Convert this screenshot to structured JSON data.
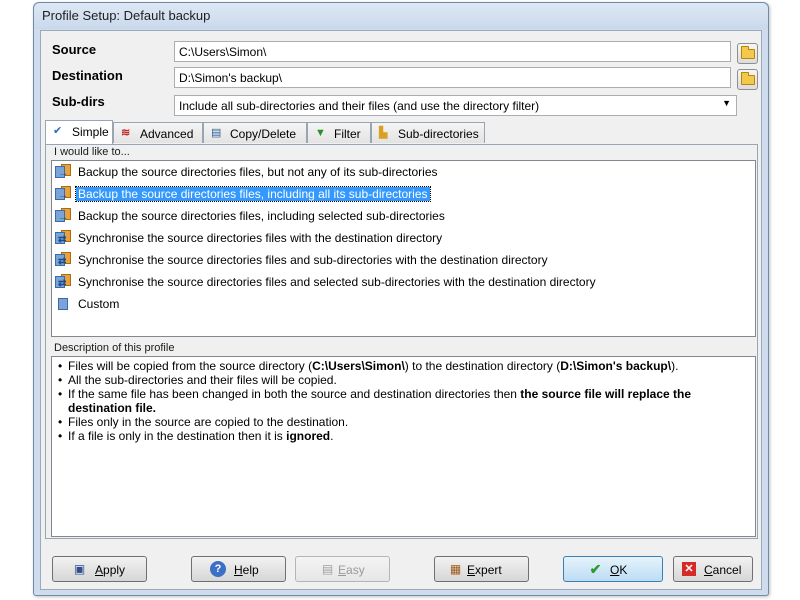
{
  "window": {
    "title": "Profile Setup: Default backup"
  },
  "fields": {
    "source_label": "Source",
    "source_value": "C:\\Users\\Simon\\",
    "destination_label": "Destination",
    "destination_value": "D:\\Simon's backup\\",
    "subdirs_label": "Sub-dirs",
    "subdirs_value": "Include all sub-directories and their files (and use the directory filter)"
  },
  "tabs": [
    {
      "label": "Simple",
      "icon": "checkmarks-icon"
    },
    {
      "label": "Advanced",
      "icon": "advanced-icon"
    },
    {
      "label": "Copy/Delete",
      "icon": "copy-delete-icon"
    },
    {
      "label": "Filter",
      "icon": "filter-icon"
    },
    {
      "label": "Sub-directories",
      "icon": "subdirectories-icon"
    }
  ],
  "simple": {
    "group_label": "I would like to...",
    "options": [
      "Backup the source directories files, but not any of its sub-directories",
      "Backup the source directories files, including all its sub-directories",
      "Backup the source directories files, including selected sub-directories",
      "Synchronise the source directories files with the destination directory",
      "Synchronise the source directories files and sub-directories with the destination directory",
      "Synchronise the source directories files and selected sub-directories with the destination directory",
      "Custom"
    ],
    "selected_index": 1,
    "description_label": "Description of this profile",
    "description": {
      "l1_a": "Files will be copied from the source directory (",
      "l1_b": "C:\\Users\\Simon\\",
      "l1_c": ") to the destination directory (",
      "l1_d": "D:\\Simon's backup\\",
      "l1_e": ").",
      "l2": "All the sub-directories and their files will be copied.",
      "l3_a": "If the same file has been changed in both the source and destination directories then ",
      "l3_b": "the source file will replace the destination file.",
      "l4": "Files only in the source are copied to the destination.",
      "l5_a": "If a file is only in the destination then it is ",
      "l5_b": "ignored",
      "l5_c": "."
    }
  },
  "buttons": {
    "apply_first": "A",
    "apply_rest": "pply",
    "help_first": "H",
    "help_rest": "elp",
    "easy_first": "E",
    "easy_rest": "asy",
    "expert_first": "E",
    "expert_rest": "xpert",
    "ok_first": "O",
    "ok_rest": "K",
    "cancel_first": "C",
    "cancel_rest": "ancel"
  },
  "colors": {
    "selection": "#3399ff",
    "window_frame": "#cfdced",
    "ok_check": "#2e9a2e",
    "cancel_x": "#d42a2a"
  }
}
